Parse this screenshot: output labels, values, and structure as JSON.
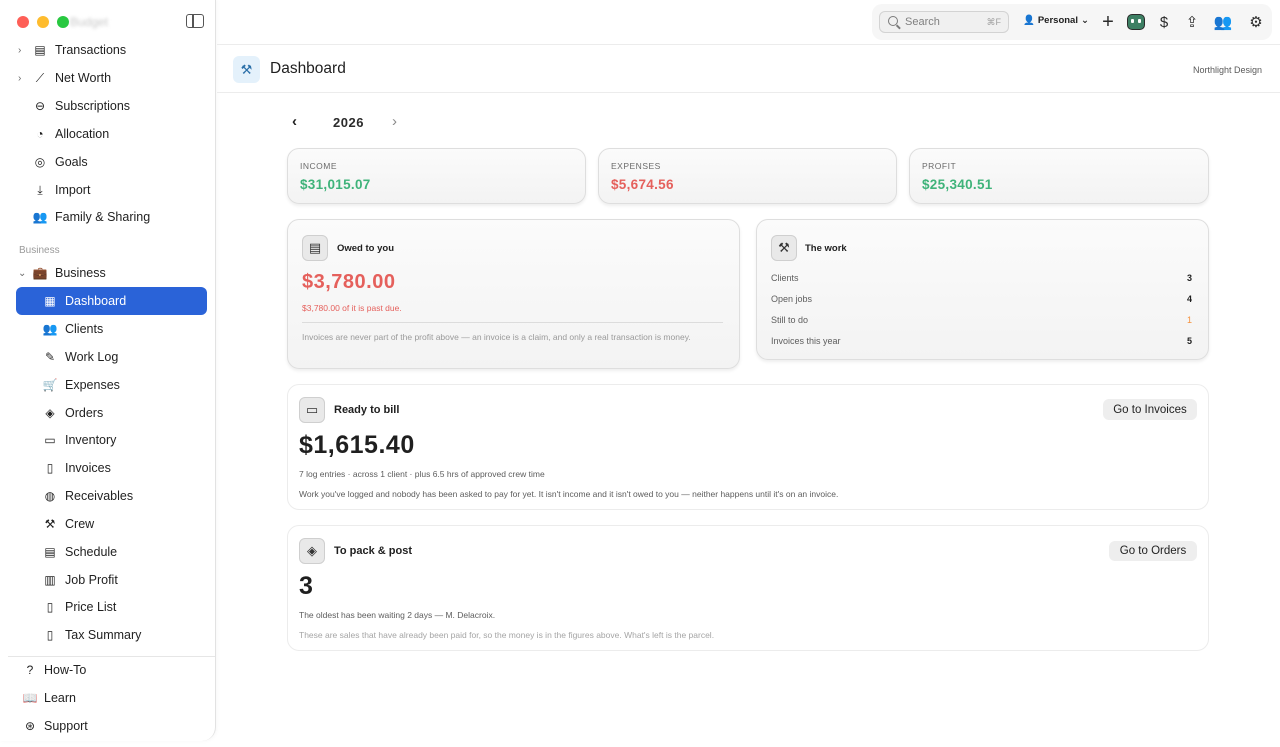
{
  "window": {
    "sidebar_title": "Budget"
  },
  "sidebar": {
    "top_items": [
      {
        "label": "Transactions",
        "icon": "list-icon"
      },
      {
        "label": "Net Worth",
        "icon": "chart-line-icon"
      },
      {
        "label": "Subscriptions",
        "icon": "subscriptions-icon"
      },
      {
        "label": "Allocation",
        "icon": "pie-icon"
      },
      {
        "label": "Goals",
        "icon": "target-icon"
      },
      {
        "label": "Import",
        "icon": "import-icon"
      },
      {
        "label": "Family & Sharing",
        "icon": "people-icon"
      }
    ],
    "section_label": "Business",
    "business_group": "Business",
    "business_items": [
      {
        "label": "Dashboard",
        "active": true
      },
      {
        "label": "Clients"
      },
      {
        "label": "Work Log"
      },
      {
        "label": "Expenses"
      },
      {
        "label": "Orders"
      },
      {
        "label": "Inventory"
      },
      {
        "label": "Invoices"
      },
      {
        "label": "Receivables"
      },
      {
        "label": "Crew"
      },
      {
        "label": "Schedule"
      },
      {
        "label": "Job Profit"
      },
      {
        "label": "Price List"
      },
      {
        "label": "Tax Summary"
      }
    ],
    "bottom_items": [
      {
        "label": "How-To"
      },
      {
        "label": "Learn"
      },
      {
        "label": "Support"
      }
    ]
  },
  "toolbar": {
    "search_placeholder": "Search",
    "search_shortcut": "⌘F",
    "profile": "Personal"
  },
  "header": {
    "title": "Dashboard",
    "org": "Northlight Design"
  },
  "year": "2026",
  "stats": [
    {
      "label": "INCOME",
      "value": "$31,015.07",
      "color": "#3fb37a"
    },
    {
      "label": "EXPENSES",
      "value": "$5,674.56",
      "color": "#e5605c"
    },
    {
      "label": "PROFIT",
      "value": "$25,340.51",
      "color": "#3fb37a"
    }
  ],
  "owed": {
    "title": "Owed to you",
    "amount": "$3,780.00",
    "past_due": "$3,780.00 of it is past due.",
    "note": "Invoices are never part of the profit above — an invoice is a claim, and only a real transaction is money."
  },
  "work": {
    "title": "The work",
    "rows": [
      {
        "label": "Clients",
        "value": "3"
      },
      {
        "label": "Open jobs",
        "value": "4"
      },
      {
        "label": "Still to do",
        "value": "1"
      },
      {
        "label": "Invoices this year",
        "value": "5"
      }
    ]
  },
  "ready_to_bill": {
    "title": "Ready to bill",
    "button": "Go to Invoices",
    "amount": "$1,615.40",
    "meta": "7 log entries · across 1 client · plus 6.5 hrs of approved crew time",
    "note": "Work you've logged and nobody has been asked to pay for yet. It isn't income and it isn't owed to you — neither happens until it's on an invoice."
  },
  "to_pack": {
    "title": "To pack & post",
    "button": "Go to Orders",
    "count": "3",
    "meta": "The oldest has been waiting 2 days — M. Delacroix.",
    "note": "These are sales that have already been paid for, so the money is in the figures above. What's left is the parcel."
  }
}
